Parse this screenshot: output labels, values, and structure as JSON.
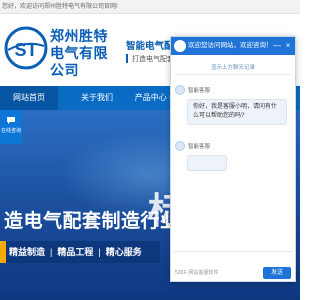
{
  "notice": {
    "text": "您好，欢迎访问郑州胜特电气有限公司官网!"
  },
  "company": {
    "name_line1": "郑州胜特",
    "name_line2": "电气有限公司"
  },
  "slogan": {
    "main": "智能电气配套箱柜解决方案",
    "sub": "打造电气配套制造业标杆"
  },
  "nav": {
    "items": [
      {
        "label": "网站首页",
        "active": true
      },
      {
        "label": "关于我们",
        "active": false
      },
      {
        "label": "产品中心",
        "active": false,
        "caret": "∨"
      }
    ]
  },
  "side": {
    "chat_label": "在线咨询"
  },
  "hero": {
    "big_char": "标",
    "title": "造电气配套制造行业",
    "tags": [
      "精益制造",
      "精品工程",
      "精心服务"
    ],
    "separator": "|"
  },
  "chat": {
    "title": "欢迎您访问网站，欢迎咨询！",
    "minimize": "—",
    "close": "×",
    "history_link": "显示上方聊天记录",
    "agent_name": "智能客服",
    "message_1": "你好，我是客服小明，请问有什么可以帮助您的吗?",
    "message_2": "",
    "input_placeholder": "",
    "powered_by": "53KF 网站客服软件",
    "send_label": "发送"
  },
  "colors": {
    "brand_blue": "#0a5fb4",
    "nav_blue": "#0a6bc4",
    "chat_header": "#1f72d6",
    "accent_gold": "#f2a900"
  }
}
